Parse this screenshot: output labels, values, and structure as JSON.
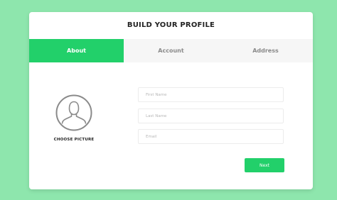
{
  "header": {
    "title": "BUILD YOUR PROFILE"
  },
  "tabs": [
    {
      "label": "About",
      "active": true
    },
    {
      "label": "Account",
      "active": false
    },
    {
      "label": "Address",
      "active": false
    }
  ],
  "avatar": {
    "icon": "user-silhouette-icon",
    "label": "CHOOSE PICTURE"
  },
  "form": {
    "first_name": {
      "value": "",
      "placeholder": "First Name"
    },
    "last_name": {
      "value": "",
      "placeholder": "Last Name"
    },
    "email": {
      "value": "",
      "placeholder": "Email"
    }
  },
  "actions": {
    "next_label": "Next"
  },
  "colors": {
    "background": "#8ee6ad",
    "accent": "#22d06a",
    "card": "#ffffff",
    "tab_inactive_bg": "#f6f6f6",
    "tab_inactive_text": "#8a8a8a"
  }
}
